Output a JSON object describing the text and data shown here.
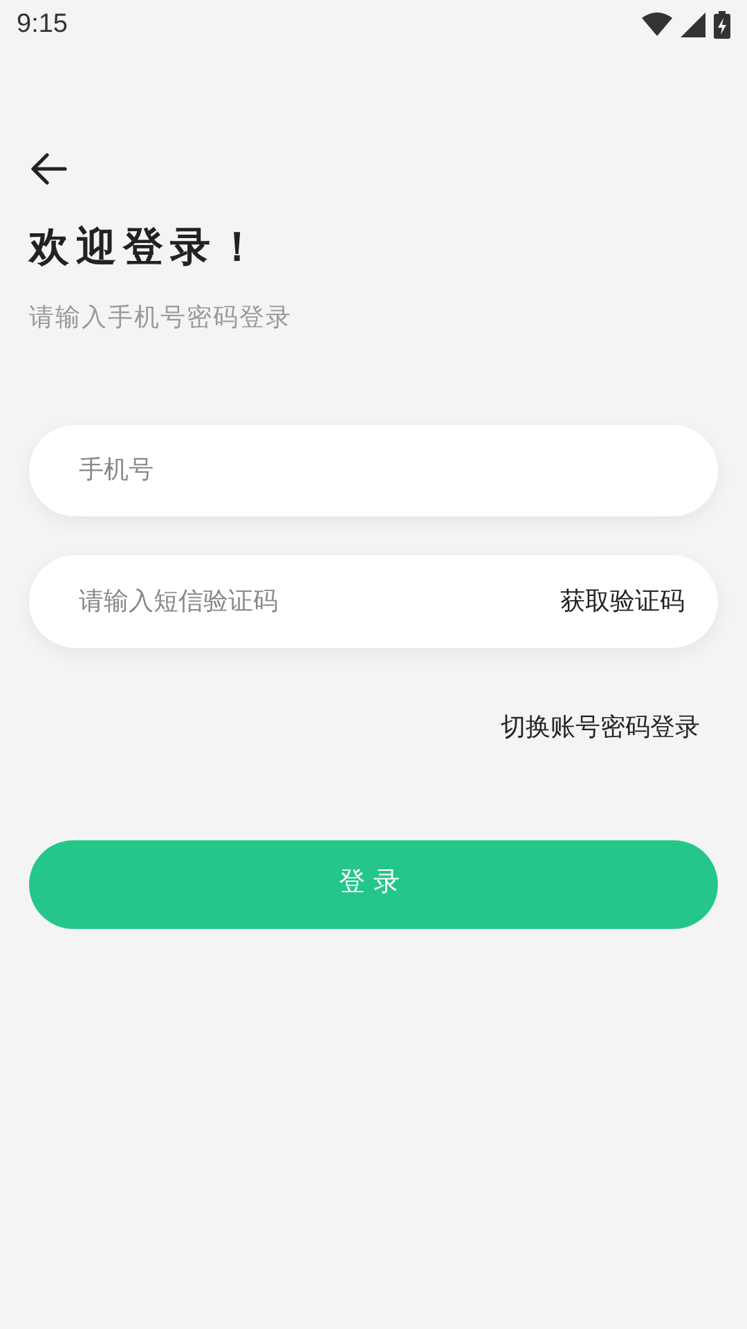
{
  "status_bar": {
    "time": "9:15"
  },
  "title": "欢迎登录！",
  "subtitle": "请输入手机号密码登录",
  "phone_field": {
    "placeholder": "手机号"
  },
  "code_field": {
    "placeholder": "请输入短信验证码",
    "action": "获取验证码"
  },
  "switch_link": "切换账号密码登录",
  "login_button": "登录"
}
